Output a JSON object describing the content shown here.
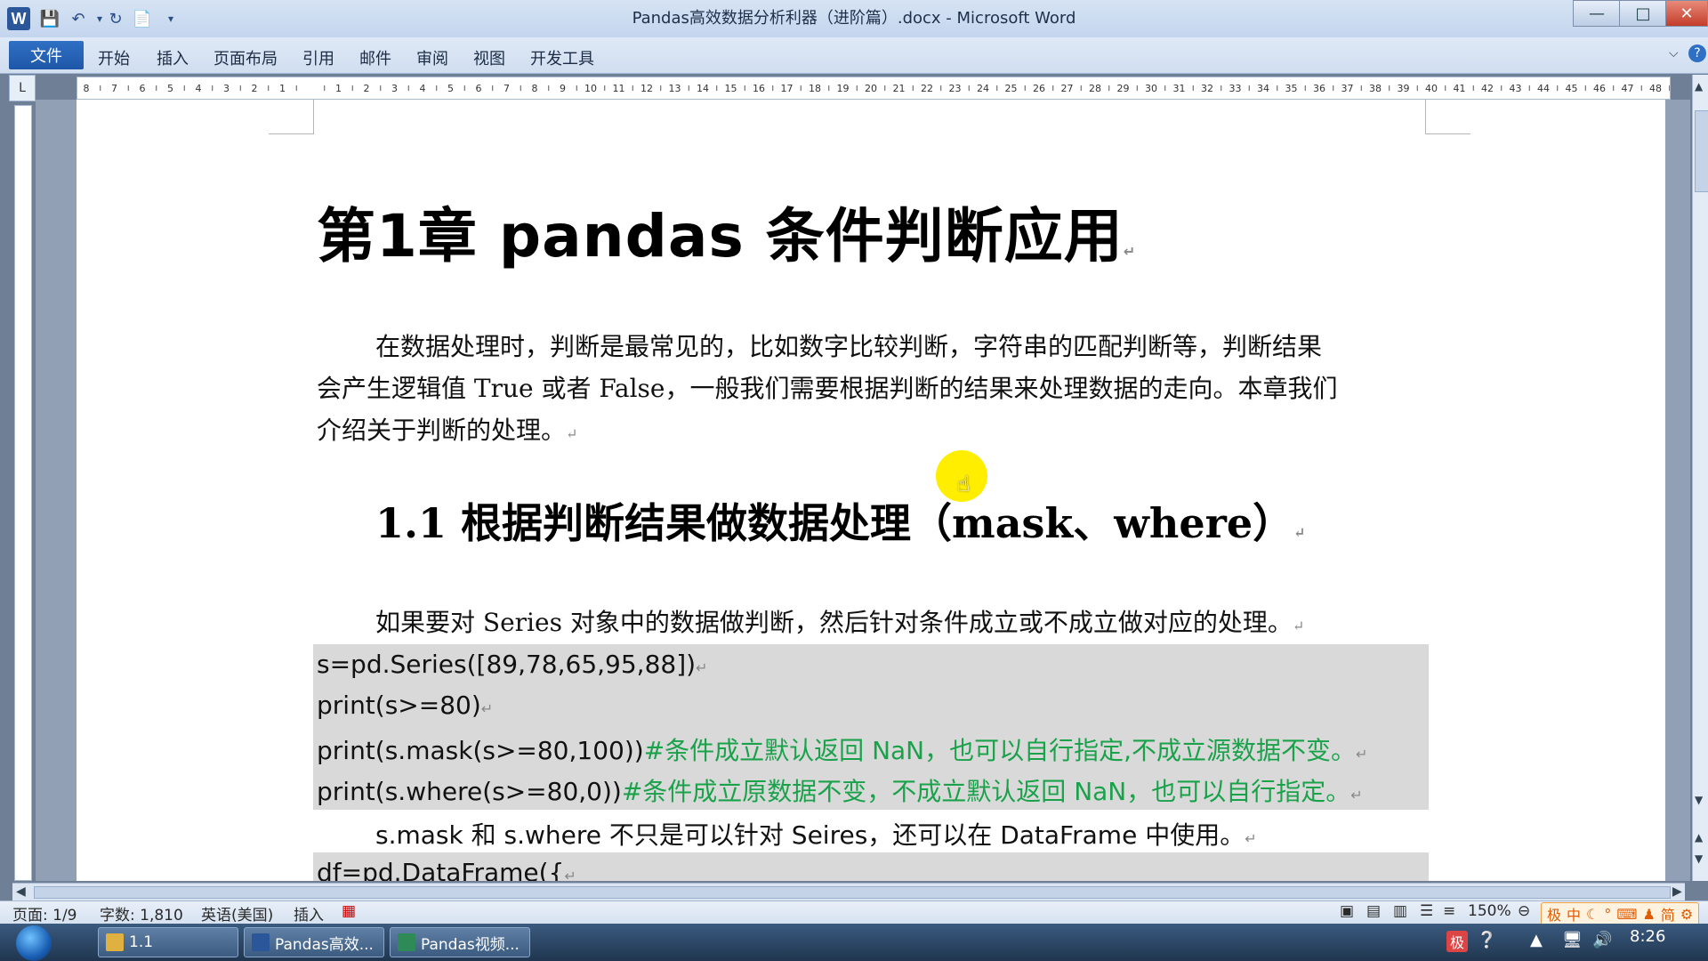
{
  "window": {
    "title": "Pandas高效数据分析利器（进阶篇）.docx - Microsoft Word",
    "app_icon": "W"
  },
  "ribbon": {
    "file_tab": "文件",
    "tabs": [
      "开始",
      "插入",
      "页面布局",
      "引用",
      "邮件",
      "审阅",
      "视图",
      "开发工具"
    ]
  },
  "document": {
    "heading1": "第1章  pandas 条件判断应用",
    "para1": [
      "在数据处理时，判断是最常见的，比如数字比较判断，字符串的匹配判断等，判断结果",
      "会产生逻辑值 True 或者 False，一般我们需要根据判断的结果来处理数据的走向。本章我们",
      "介绍关于判断的处理。"
    ],
    "heading2": "1.1  根据判断结果做数据处理（mask、where）",
    "para2": "如果要对 Series 对象中的数据做判断，然后针对条件成立或不成立做对应的处理。",
    "code1": [
      {
        "code": "s=pd.Series([89,78,65,95,88])",
        "comment": ""
      },
      {
        "code": "print(s>=80)",
        "comment": ""
      },
      {
        "code": "print(s.mask(s>=80,100))",
        "comment": "#条件成立默认返回 NaN，也可以自行指定,不成立源数据不变。"
      },
      {
        "code": "print(s.where(s>=80,0))",
        "comment": "#条件成立原数据不变，不成立默认返回 NaN，也可以自行指定。"
      }
    ],
    "para3": "s.mask 和 s.where 不只是可以针对 Seires，还可以在 DataFrame 中使用。",
    "code2": "df=pd.DataFrame({",
    "para_mark": "↵"
  },
  "statusbar": {
    "page": "页面: 1/9",
    "words": "字数: 1,810",
    "language": "英语(美国)",
    "mode": "插入",
    "zoom": "150%"
  },
  "ime": {
    "items": [
      "极",
      "中",
      "简"
    ]
  },
  "taskbar": {
    "items": [
      {
        "label": "1.1",
        "color": "#e0b040"
      },
      {
        "label": "Pandas高效...",
        "color": "#2b579a"
      },
      {
        "label": "Pandas视频...",
        "color": "#2e8b57"
      }
    ],
    "clock": "8:26"
  },
  "ruler": {
    "ticks": [
      "8",
      "7",
      "6",
      "5",
      "4",
      "3",
      "2",
      "1",
      "",
      "1",
      "2",
      "3",
      "4",
      "5",
      "6",
      "7",
      "8",
      "9",
      "10",
      "11",
      "12",
      "13",
      "14",
      "15",
      "16",
      "17",
      "18",
      "19",
      "20",
      "21",
      "22",
      "23",
      "24",
      "25",
      "26",
      "27",
      "28",
      "29",
      "30",
      "31",
      "32",
      "33",
      "34",
      "35",
      "36",
      "37",
      "38",
      "39",
      "40",
      "41",
      "42",
      "43",
      "44",
      "45",
      "46",
      "47",
      "48"
    ]
  }
}
